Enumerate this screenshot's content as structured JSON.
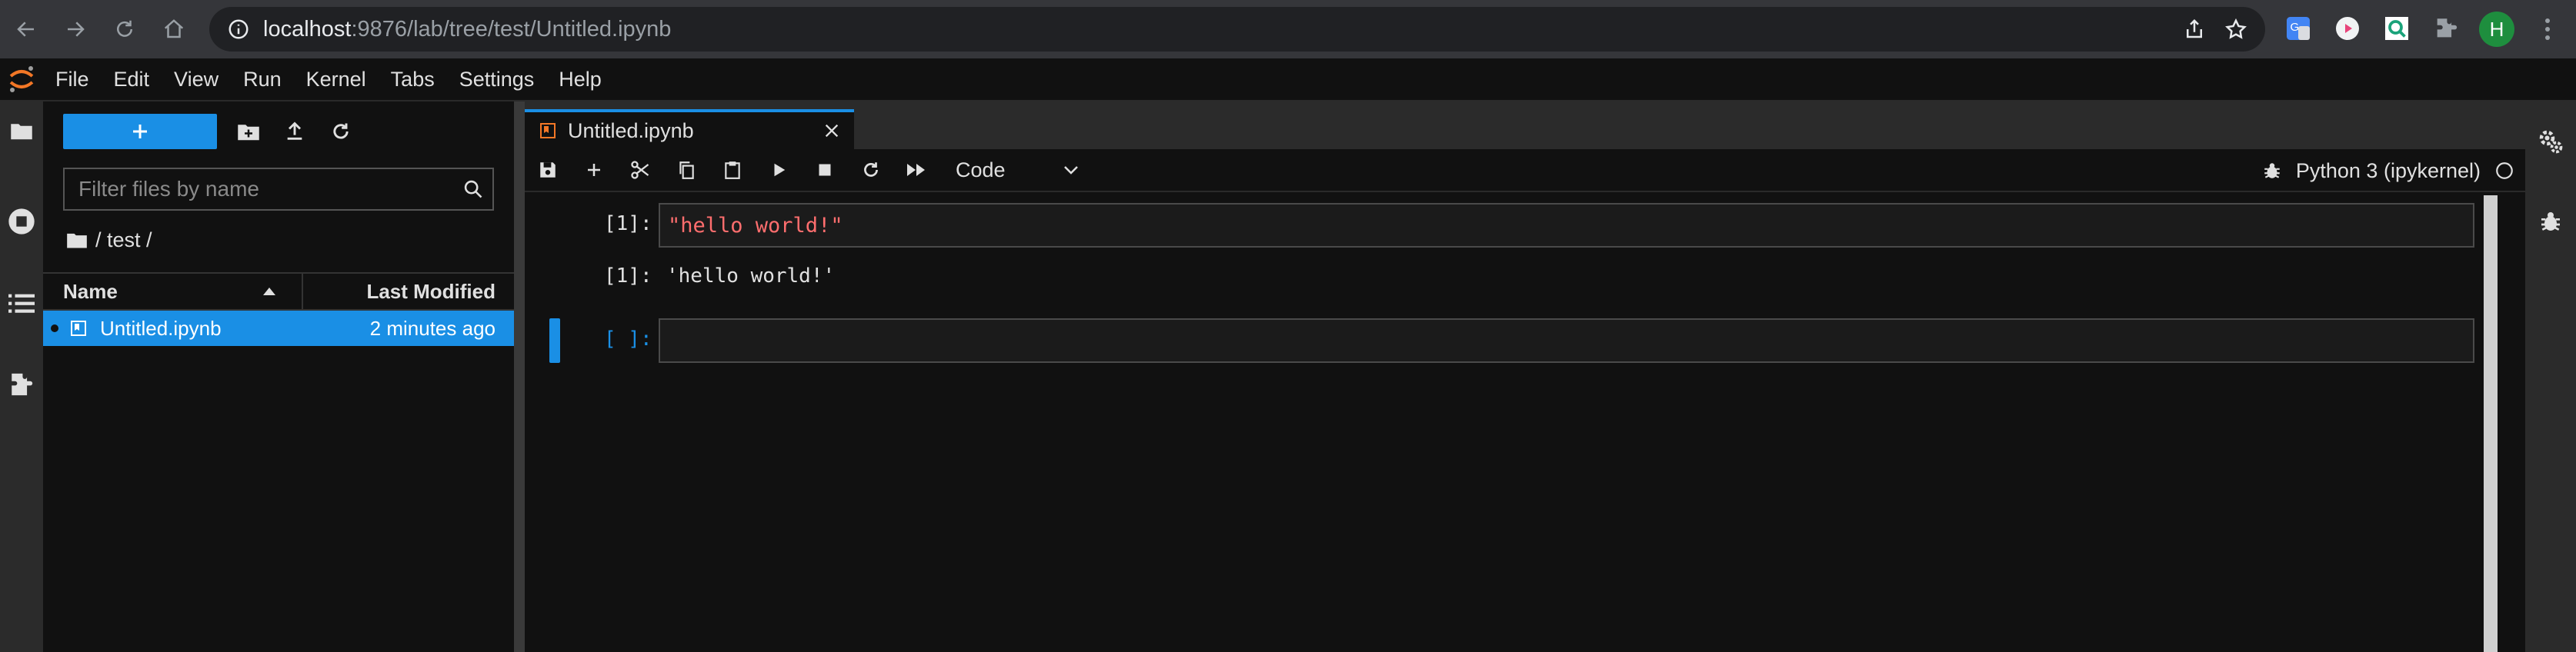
{
  "browser": {
    "url_host": "localhost",
    "url_rest": ":9876/lab/tree/test/Untitled.ipynb",
    "profile_initial": "H"
  },
  "menu": {
    "items": [
      "File",
      "Edit",
      "View",
      "Run",
      "Kernel",
      "Tabs",
      "Settings",
      "Help"
    ]
  },
  "filebrowser": {
    "filter_placeholder": "Filter files by name",
    "breadcrumb": "/ test /",
    "columns": {
      "name": "Name",
      "modified": "Last Modified"
    },
    "files": [
      {
        "name": "Untitled.ipynb",
        "modified": "2 minutes ago"
      }
    ]
  },
  "notebook": {
    "tab_title": "Untitled.ipynb",
    "cell_type": "Code",
    "kernel_name": "Python 3 (ipykernel)",
    "cells": [
      {
        "in_prompt": "[1]:",
        "source": "\"hello world!\"",
        "out_prompt": "[1]:",
        "output": "'hello world!'"
      },
      {
        "in_prompt": "[ ]:",
        "source": ""
      }
    ]
  },
  "colors": {
    "accent": "#1a8fe5",
    "string": "#ff6e6e",
    "background": "#111111",
    "sidebar": "#2b2b2b"
  }
}
